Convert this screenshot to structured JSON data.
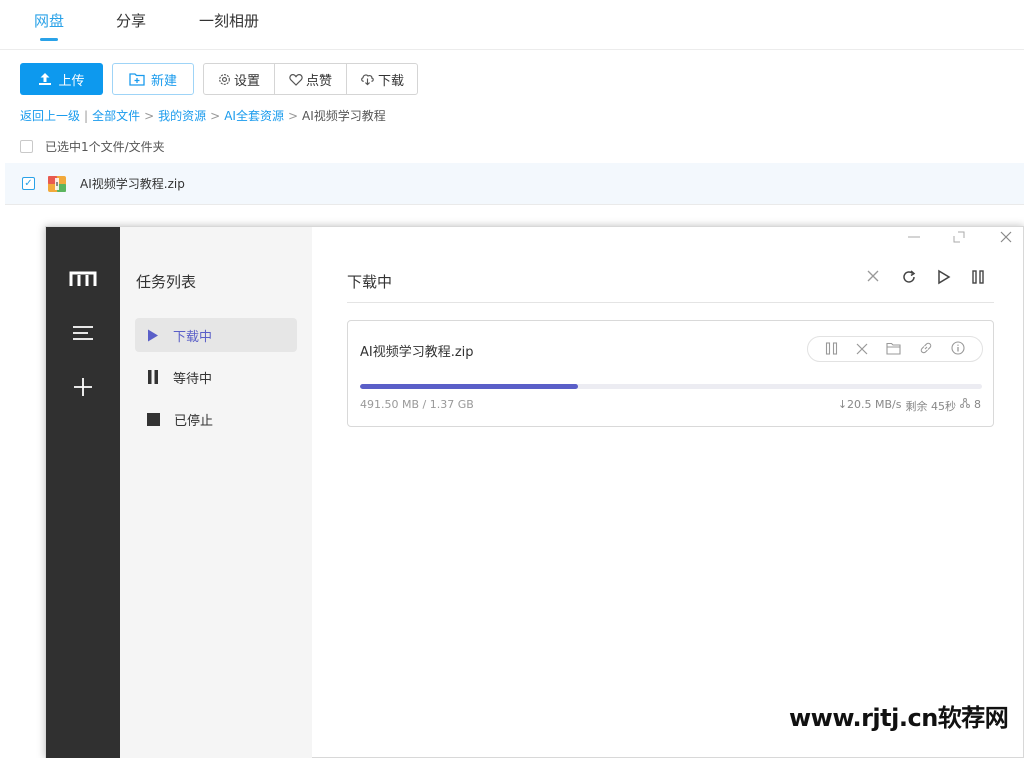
{
  "topnav": {
    "tabs": [
      "网盘",
      "分享",
      "一刻相册"
    ],
    "active_tab": "网盘"
  },
  "toolbar": {
    "upload_label": "上传",
    "new_label": "新建",
    "settings_label": "设置",
    "like_label": "点赞",
    "download_label": "下载",
    "icons": [
      "upload-icon",
      "new-folder-icon",
      "gear-icon",
      "heart-icon",
      "cloud-download-icon"
    ]
  },
  "breadcrumb": {
    "back": "返回上一级",
    "sep_bar": "|",
    "items": [
      "全部文件",
      "我的资源",
      "AI全套资源"
    ],
    "sep": ">",
    "current": "AI视频学习教程"
  },
  "selection": {
    "text": "已选中1个文件/文件夹"
  },
  "files": [
    {
      "name": "AI视频学习教程.zip",
      "checked": true,
      "icon": "zip-archive-icon"
    }
  ],
  "downloader": {
    "panel_title": "任务列表",
    "nav": [
      {
        "label": "下载中",
        "icon": "play-icon",
        "active": true
      },
      {
        "label": "等待中",
        "icon": "pause-icon",
        "active": false
      },
      {
        "label": "已停止",
        "icon": "stop-icon",
        "active": false
      }
    ],
    "main_title": "下载中",
    "task": {
      "name": "AI视频学习教程.zip",
      "progress": 0.35,
      "size_text": "491.50 MB / 1.37 GB",
      "speed_text": "↓20.5 MB/s",
      "remaining_text": "剩余 45秒",
      "connections_text": "8"
    },
    "accent": "#5a5fc8"
  },
  "colors": {
    "brand": "#0d99ee",
    "link": "#1a9bed",
    "rail": "#303030"
  },
  "watermark": "www.rjtj.cn软荐网"
}
